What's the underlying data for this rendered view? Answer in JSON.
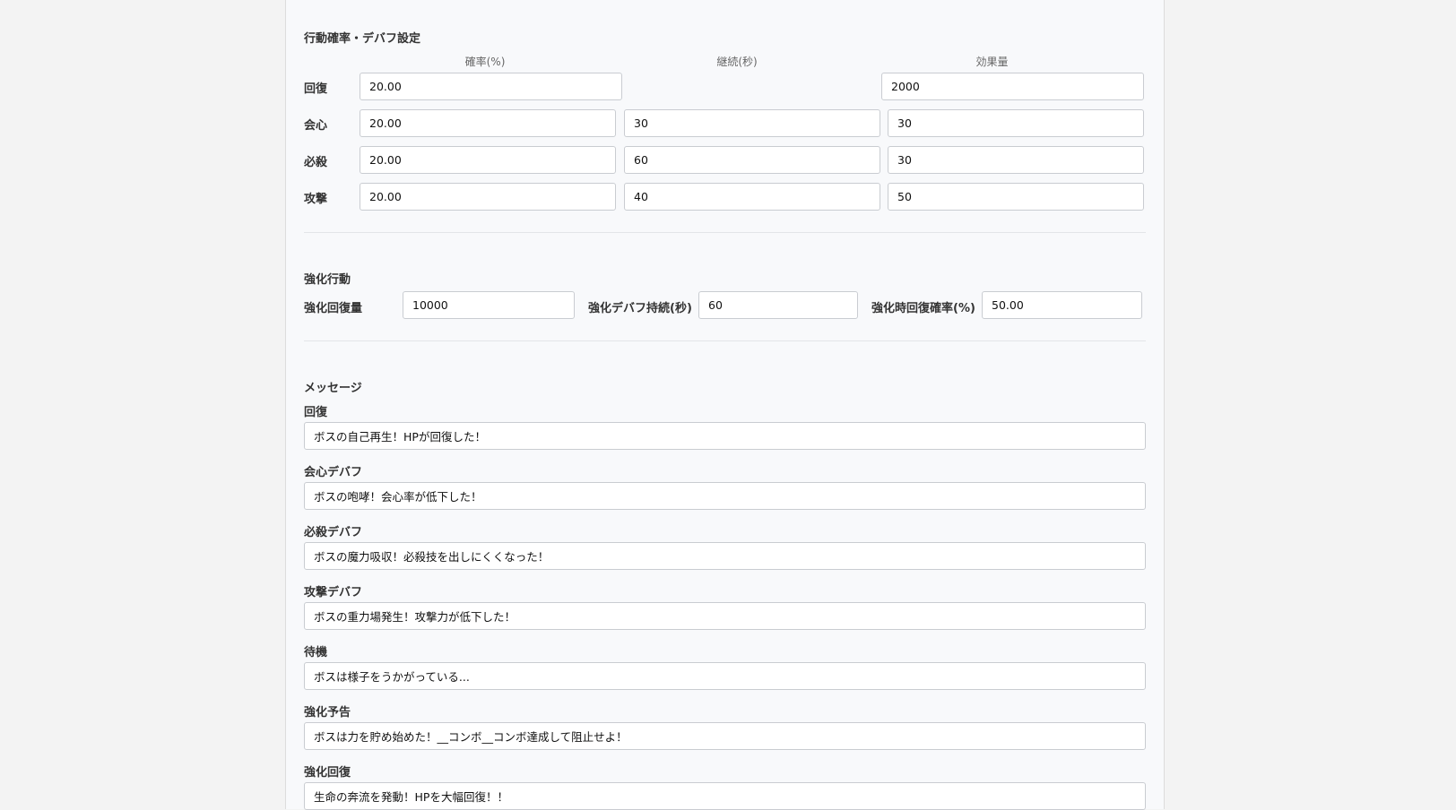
{
  "action_settings": {
    "title": "行動確率・デバフ設定",
    "columns": [
      "確率(%)",
      "継続(秒)",
      "効果量"
    ],
    "rows": [
      {
        "label": "回復",
        "probability": "20.00",
        "duration": "",
        "amount": "2000"
      },
      {
        "label": "会心",
        "probability": "20.00",
        "duration": "30",
        "amount": "30"
      },
      {
        "label": "必殺",
        "probability": "20.00",
        "duration": "60",
        "amount": "30"
      },
      {
        "label": "攻撃",
        "probability": "20.00",
        "duration": "40",
        "amount": "50"
      }
    ]
  },
  "enhanced_action": {
    "title": "強化行動",
    "heal_amount_label": "強化回復量",
    "heal_amount": "10000",
    "debuff_duration_label": "強化デバフ持続(秒)",
    "debuff_duration": "60",
    "heal_probability_label": "強化時回復確率(%)",
    "heal_probability": "50.00"
  },
  "messages": {
    "title": "メッセージ",
    "items": [
      {
        "label": "回復",
        "value": "ボスの自己再生！HPが回復した！"
      },
      {
        "label": "会心デバフ",
        "value": "ボスの咆哮！会心率が低下した！"
      },
      {
        "label": "必殺デバフ",
        "value": "ボスの魔力吸収！必殺技を出しにくくなった！"
      },
      {
        "label": "攻撃デバフ",
        "value": "ボスの重力場発生！攻撃力が低下した！"
      },
      {
        "label": "待機",
        "value": "ボスは様子をうかがっている..."
      },
      {
        "label": "強化予告",
        "value": "ボスは力を貯め始めた！__コンボ__コンボ達成して阻止せよ！"
      },
      {
        "label": "強化回復",
        "value": "生命の奔流を発動！HPを大幅回復！！"
      }
    ]
  }
}
